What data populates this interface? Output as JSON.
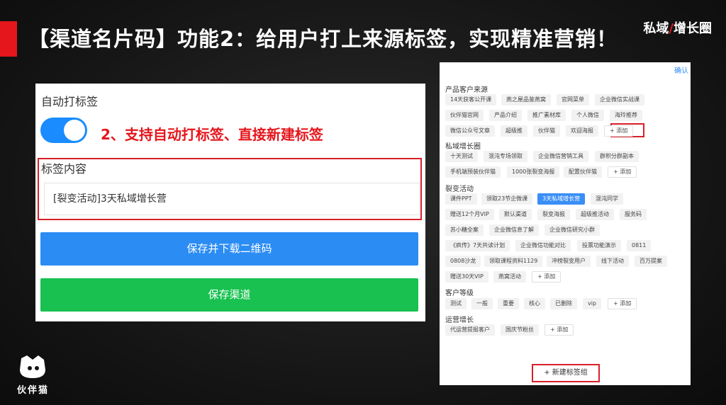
{
  "headline": "【渠道名片码】功能2：给用户打上来源标签，实现精准营销！",
  "brand": {
    "part1": "私域",
    "slash": "/",
    "part2": "增长圈"
  },
  "left_panel": {
    "auto_tag_label": "自动打标签",
    "toggle_on": true,
    "callout": "2、支持自动打标签、直接新建标签",
    "tag_content_label": "标签内容",
    "tag_content_value": "[裂变活动]3天私域增长营",
    "save_download_button": "保存并下载二维码",
    "save_channel_button": "保存渠道"
  },
  "logo_text": "伙伴猫",
  "right_panel": {
    "confirm": "确认",
    "groups": [
      {
        "title": "产品客户来源",
        "tags": [
          "14天获客公开课",
          "燕之屋品鉴燕窝",
          "官网菜单",
          "企业微信实战课",
          "伙伴猫官网",
          "产品介绍",
          "推广素材库",
          "个人微信",
          "海玲推荐",
          "微信公众号文章",
          "超级推",
          "伙伴猫",
          "欢迎海报"
        ],
        "add": "+ 添加"
      },
      {
        "title": "私域增长圈",
        "tags": [
          "十天测试",
          "混沌专场领取",
          "企业微信营销工具",
          "群积分群副本",
          "手机端预装伙伴猫",
          "1000张裂变海报",
          "配置伙伴猫"
        ],
        "add": "+ 添加"
      },
      {
        "title": "裂变活动",
        "tags": [
          "课件PPT",
          "领取23节企微课",
          "3天私域增长营",
          "混沌同学",
          "赠送12个月VIP",
          "默认渠道",
          "裂变海报",
          "超级推活动",
          "服务码",
          "苏小糖全案",
          "企业微信息了解",
          "企业微信研究小群",
          "《疯传》7天共读计划",
          "企业微信功能对比",
          "投票功能演示",
          "0811",
          "0808沙龙",
          "领取课程资料1129",
          "冲榜裂变用户",
          "线下活动",
          "百万提案",
          "赠送30天VIP",
          "燕窝活动"
        ],
        "add": "+ 添加",
        "selected": "3天私域增长营"
      },
      {
        "title": "客户等级",
        "tags": [
          "测试",
          "一般",
          "重要",
          "核心",
          "已删除",
          "vip"
        ],
        "add": "+ 添加"
      },
      {
        "title": "运营增长",
        "tags": [
          "代运营提报客户",
          "国庆节粉丝"
        ],
        "add": "+ 添加"
      }
    ],
    "new_group_button": "+ 新建标签组"
  }
}
